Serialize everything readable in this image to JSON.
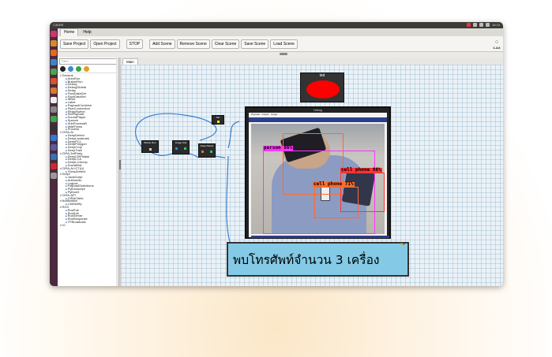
{
  "window": {
    "title": "C3DRE"
  },
  "system_tray": {
    "time": "16:15"
  },
  "menu_tabs": [
    "Home",
    "Help"
  ],
  "toolbar": {
    "buttons": [
      "Save Project",
      "Open Project",
      "STOP",
      "Add Scene",
      "Remove Scene",
      "Clear Scene",
      "Save Scene",
      "Load Scene"
    ]
  },
  "version": "1.4.6",
  "sidebar": {
    "filter_placeholder": "Filter",
    "tree": [
      {
        "type": "cat",
        "label": "General"
      },
      {
        "type": "item",
        "label": "AutoRun"
      },
      {
        "type": "item",
        "label": "ButtonRun"
      },
      {
        "type": "item",
        "label": "Debug"
      },
      {
        "type": "item",
        "label": "DebugGlobal"
      },
      {
        "type": "item",
        "label": "Delay"
      },
      {
        "type": "item",
        "label": "FlowDataGet"
      },
      {
        "type": "item",
        "label": "FlowDataSet"
      },
      {
        "type": "item",
        "label": "IfElse"
      },
      {
        "type": "item",
        "label": "Label"
      },
      {
        "type": "item",
        "label": "PayloadCombine"
      },
      {
        "type": "item",
        "label": "PipeConnection"
      },
      {
        "type": "item",
        "label": "RelaySwitch"
      },
      {
        "type": "item",
        "label": "SetPayload"
      },
      {
        "type": "item",
        "label": "SoundPlayer"
      },
      {
        "type": "item",
        "label": "Speech"
      },
      {
        "type": "item",
        "label": "SubProcessB"
      },
      {
        "type": "item",
        "label": "WaitFlows"
      },
      {
        "type": "item",
        "label": "Process"
      },
      {
        "type": "cat",
        "label": "CIRA-AI"
      },
      {
        "type": "item",
        "label": "DeepDetect"
      },
      {
        "type": "item",
        "label": "DeepLandmark"
      },
      {
        "type": "item",
        "label": "DeepPCL"
      },
      {
        "type": "item",
        "label": "DeepPolygon"
      },
      {
        "type": "item",
        "label": "DeepCrop"
      },
      {
        "type": "item",
        "label": "DeepTrain"
      },
      {
        "type": "cat",
        "label": "CIRA-3rdParty"
      },
      {
        "type": "item",
        "label": "DeepCRFMask"
      },
      {
        "type": "item",
        "label": "DeepLCA"
      },
      {
        "type": "item",
        "label": "DeepLCAcrop"
      },
      {
        "type": "item",
        "label": "SocialDist"
      },
      {
        "type": "cat",
        "label": "CIRA-AI-ICT(U)"
      },
      {
        "type": "item",
        "label": "*DeepDetect"
      },
      {
        "type": "cat",
        "label": "Script"
      },
      {
        "type": "item",
        "label": "JavaScript"
      },
      {
        "type": "item",
        "label": "Arithmetic"
      },
      {
        "type": "item",
        "label": "Logical"
      },
      {
        "type": "item",
        "label": "PayloadSelections"
      },
      {
        "type": "item",
        "label": "Pythonscript"
      },
      {
        "type": "item",
        "label": "Python3"
      },
      {
        "type": "cat",
        "label": "CIRA-API"
      },
      {
        "type": "item",
        "label": "CIRAClient"
      },
      {
        "type": "cat",
        "label": "Notification"
      },
      {
        "type": "item",
        "label": "LineNotify"
      },
      {
        "type": "cat",
        "label": "ROS"
      },
      {
        "type": "item",
        "label": "RosPub"
      },
      {
        "type": "item",
        "label": "RosSub"
      },
      {
        "type": "item",
        "label": "RosServer"
      },
      {
        "type": "item",
        "label": "RosResponse"
      },
      {
        "type": "item",
        "label": "TFBroadcast"
      },
      {
        "type": "cat",
        "label": "IO"
      }
    ]
  },
  "canvas": {
    "tab": "Main",
    "nodes": [
      {
        "name": "node-button-run",
        "label": "Button Run"
      },
      {
        "name": "node-image-sub",
        "label": "Image Sub"
      },
      {
        "name": "node-deep-detect",
        "label": "Deep Detect"
      },
      {
        "name": "node-set",
        "label": "Set"
      }
    ],
    "led_panel": {
      "title": "led"
    },
    "camera_window": {
      "title": "Debug",
      "menu": [
        "Payload",
        "Output",
        "Image"
      ],
      "detections": [
        {
          "label": "person 86%",
          "color": "#ff33ff"
        },
        {
          "label": "cell phone 98%",
          "color": "#ff3333"
        },
        {
          "label": "cell phone 71%",
          "color": "#ff6a2a"
        }
      ]
    },
    "caption": "พบโทรศัพท์จำนวน 3 เครื่อง"
  }
}
